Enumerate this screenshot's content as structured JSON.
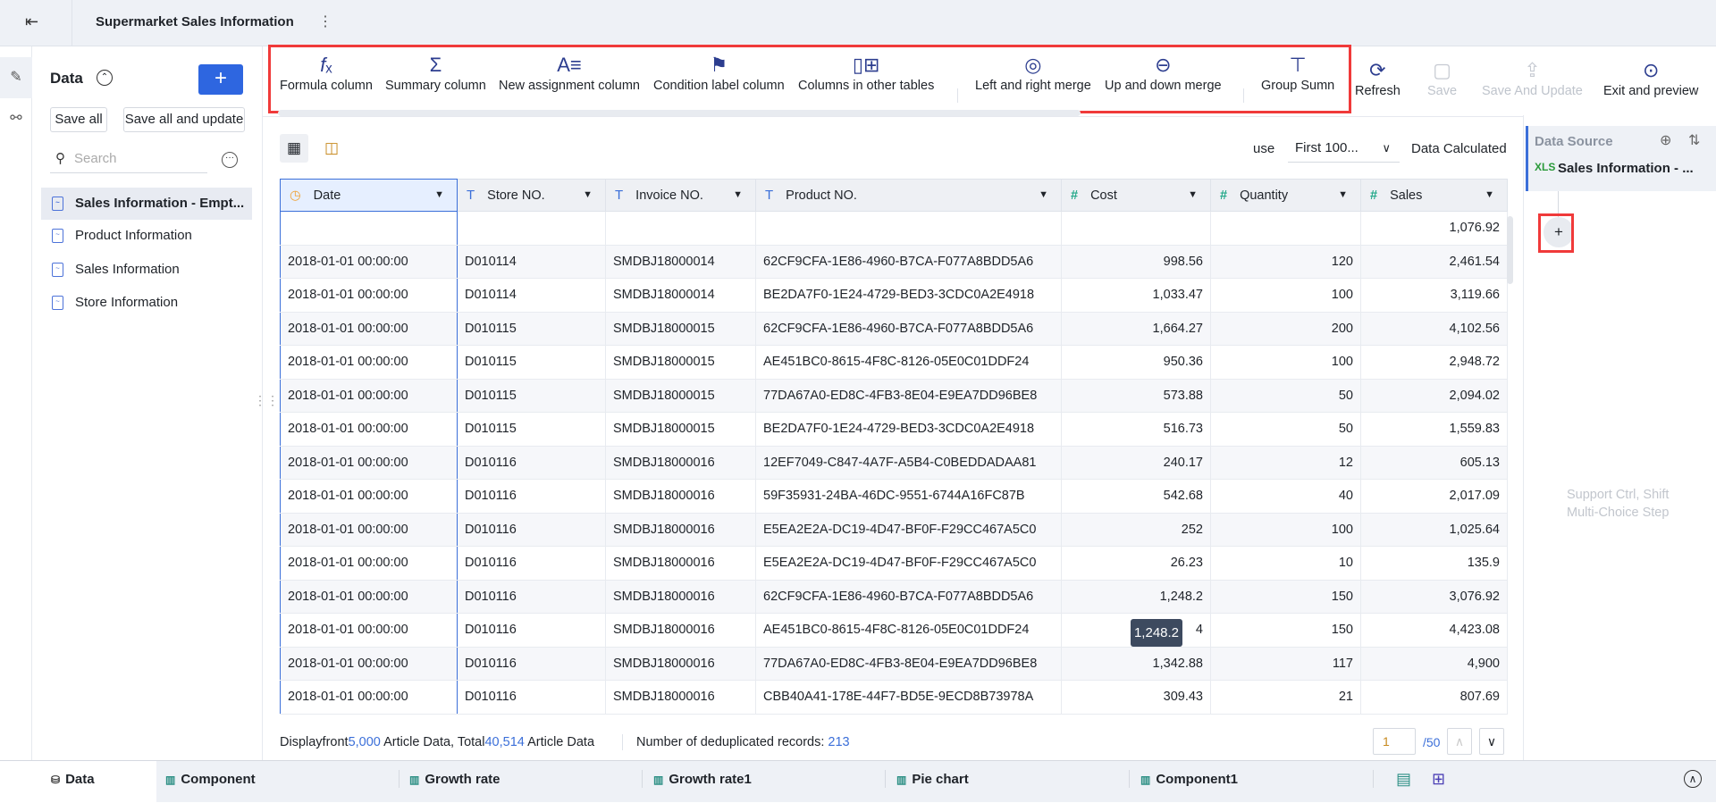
{
  "header": {
    "title": "Supermarket Sales Information"
  },
  "left": {
    "title": "Data",
    "save_all": "Save all",
    "save_all_update": "Save all and update",
    "search_placeholder": "Search",
    "items": [
      {
        "label": "Sales Information - Empt..."
      },
      {
        "label": "Product Information"
      },
      {
        "label": "Sales Information"
      },
      {
        "label": "Store Information"
      }
    ]
  },
  "toolbar": {
    "tools": [
      "Formula column",
      "Summary column",
      "New assignment column",
      "Condition label column",
      "Columns in other tables",
      "Left and right merge",
      "Up and down merge",
      "Group Sumn"
    ],
    "refresh": "Refresh",
    "save": "Save",
    "save_update": "Save And Update",
    "exit_preview": "Exit and preview"
  },
  "view": {
    "use": "use",
    "rows_select": "First 100...",
    "calc": "Data Calculated"
  },
  "table": {
    "columns": [
      "Date",
      "Store NO.",
      "Invoice NO.",
      "Product NO.",
      "Cost",
      "Quantity",
      "Sales"
    ],
    "summary_sales": "1,076.92",
    "rows": [
      [
        "2018-01-01 00:00:00",
        "D010114",
        "SMDBJ18000014",
        "62CF9CFA-1E86-4960-B7CA-F077A8BDD5A6",
        "998.56",
        "120",
        "2,461.54"
      ],
      [
        "2018-01-01 00:00:00",
        "D010114",
        "SMDBJ18000014",
        "BE2DA7F0-1E24-4729-BED3-3CDC0A2E4918",
        "1,033.47",
        "100",
        "3,119.66"
      ],
      [
        "2018-01-01 00:00:00",
        "D010115",
        "SMDBJ18000015",
        "62CF9CFA-1E86-4960-B7CA-F077A8BDD5A6",
        "1,664.27",
        "200",
        "4,102.56"
      ],
      [
        "2018-01-01 00:00:00",
        "D010115",
        "SMDBJ18000015",
        "AE451BC0-8615-4F8C-8126-05E0C01DDF24",
        "950.36",
        "100",
        "2,948.72"
      ],
      [
        "2018-01-01 00:00:00",
        "D010115",
        "SMDBJ18000015",
        "77DA67A0-ED8C-4FB3-8E04-E9EA7DD96BE8",
        "573.88",
        "50",
        "2,094.02"
      ],
      [
        "2018-01-01 00:00:00",
        "D010115",
        "SMDBJ18000015",
        "BE2DA7F0-1E24-4729-BED3-3CDC0A2E4918",
        "516.73",
        "50",
        "1,559.83"
      ],
      [
        "2018-01-01 00:00:00",
        "D010116",
        "SMDBJ18000016",
        "12EF7049-C847-4A7F-A5B4-C0BEDDADAA81",
        "240.17",
        "12",
        "605.13"
      ],
      [
        "2018-01-01 00:00:00",
        "D010116",
        "SMDBJ18000016",
        "59F35931-24BA-46DC-9551-6744A16FC87B",
        "542.68",
        "40",
        "2,017.09"
      ],
      [
        "2018-01-01 00:00:00",
        "D010116",
        "SMDBJ18000016",
        "E5EA2E2A-DC19-4D47-BF0F-F29CC467A5C0",
        "252",
        "100",
        "1,025.64"
      ],
      [
        "2018-01-01 00:00:00",
        "D010116",
        "SMDBJ18000016",
        "E5EA2E2A-DC19-4D47-BF0F-F29CC467A5C0",
        "26.23",
        "10",
        "135.9"
      ],
      [
        "2018-01-01 00:00:00",
        "D010116",
        "SMDBJ18000016",
        "62CF9CFA-1E86-4960-B7CA-F077A8BDD5A6",
        "1,248.2",
        "150",
        "3,076.92"
      ],
      [
        "2018-01-01 00:00:00",
        "D010116",
        "SMDBJ18000016",
        "AE451BC0-8615-4F8C-8126-05E0C01DDF24",
        "4",
        "150",
        "4,423.08"
      ],
      [
        "2018-01-01 00:00:00",
        "D010116",
        "SMDBJ18000016",
        "77DA67A0-ED8C-4FB3-8E04-E9EA7DD96BE8",
        "1,342.88",
        "117",
        "4,900"
      ],
      [
        "2018-01-01 00:00:00",
        "D010116",
        "SMDBJ18000016",
        "CBB40A41-178E-44F7-BD5E-9ECD8B73978A",
        "309.43",
        "21",
        "807.69"
      ]
    ],
    "tooltip": "1,248.2"
  },
  "footer": {
    "display_prefix": "Displayfront",
    "display_count": "5,000",
    "display_mid": "Article Data, Total",
    "total_count": "40,514",
    "display_suffix": "Article Data",
    "dedup_label": "Number of deduplicated records:",
    "dedup_count": "213",
    "page": "1",
    "page_total": "/50"
  },
  "right": {
    "title": "Data Source",
    "source": "Sales Information - ...",
    "xls": "XLS",
    "hint1": "Support Ctrl, Shift",
    "hint2": "Multi-Choice Step"
  },
  "tabs": [
    "Data",
    "Component",
    "Growth rate",
    "Growth rate1",
    "Pie chart",
    "Component1"
  ]
}
